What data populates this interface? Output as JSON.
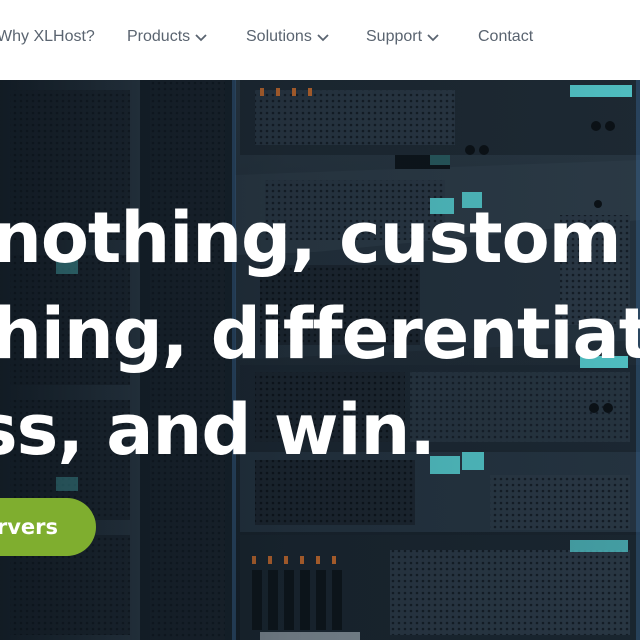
{
  "nav": {
    "items": [
      {
        "label": "Why XLHost?",
        "has_dropdown": false
      },
      {
        "label": "Products",
        "has_dropdown": true
      },
      {
        "label": "Solutions",
        "has_dropdown": true
      },
      {
        "label": "Support",
        "has_dropdown": true
      },
      {
        "label": "Contact",
        "has_dropdown": false
      }
    ]
  },
  "hero": {
    "headline_lines": [
      "nothing, custom",
      "hing, differentiat",
      "ss, and win."
    ],
    "cta_label": "rvers"
  },
  "colors": {
    "nav_bg": "#ffffff",
    "nav_text": "#5a6470",
    "cta_bg": "#7fae2f",
    "headline": "#ffffff",
    "server_accent": "#53c6c9"
  }
}
